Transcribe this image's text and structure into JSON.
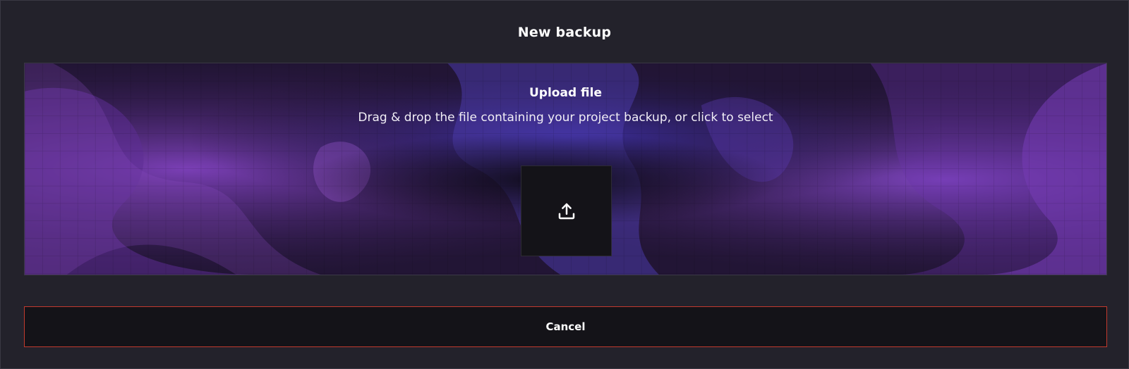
{
  "dialog": {
    "title": "New backup"
  },
  "dropzone": {
    "heading": "Upload file",
    "description": "Drag & drop the file containing your project backup, or click to select",
    "icon": "upload-icon"
  },
  "actions": {
    "cancel_label": "Cancel"
  },
  "colors": {
    "dialog_background": "#23222b",
    "button_background": "#141318",
    "cancel_border": "#c23a2e",
    "accent_purple": "#6b3aa8",
    "accent_indigo": "#3c2f9e"
  }
}
